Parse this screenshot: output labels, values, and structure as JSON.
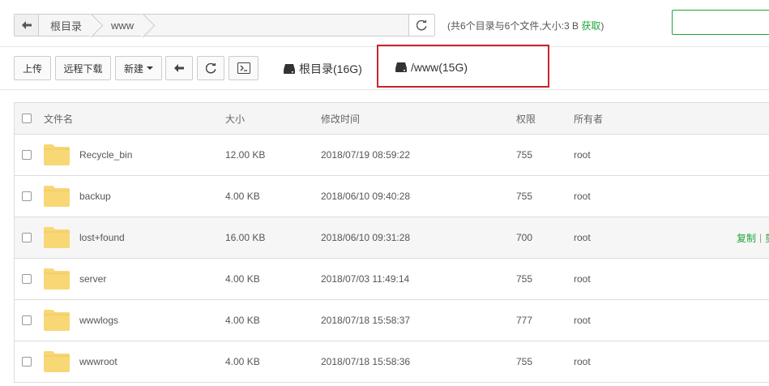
{
  "address": {
    "crumbs": [
      "根目录",
      "www"
    ]
  },
  "summary": {
    "text": "(共6个目录与6个文件,大小:3 B ",
    "link": "获取",
    "tail": ")"
  },
  "toolbar": {
    "upload": "上传",
    "remote_download": "远程下载",
    "new": "新建",
    "disks": [
      {
        "label": "根目录(16G)"
      },
      {
        "label": "/www(15G)"
      }
    ]
  },
  "table": {
    "headers": {
      "name": "文件名",
      "size": "大小",
      "mtime": "修改时间",
      "perm": "权限",
      "owner": "所有者"
    },
    "rows": [
      {
        "name": "Recycle_bin",
        "size": "12.00 KB",
        "mtime": "2018/07/19 08:59:22",
        "perm": "755",
        "owner": "root"
      },
      {
        "name": "backup",
        "size": "4.00 KB",
        "mtime": "2018/06/10 09:40:28",
        "perm": "755",
        "owner": "root"
      },
      {
        "name": "lost+found",
        "size": "16.00 KB",
        "mtime": "2018/06/10 09:31:28",
        "perm": "700",
        "owner": "root",
        "actions": [
          "复制",
          "剪"
        ]
      },
      {
        "name": "server",
        "size": "4.00 KB",
        "mtime": "2018/07/03 11:49:14",
        "perm": "755",
        "owner": "root"
      },
      {
        "name": "wwwlogs",
        "size": "4.00 KB",
        "mtime": "2018/07/18 15:58:37",
        "perm": "777",
        "owner": "root"
      },
      {
        "name": "wwwroot",
        "size": "4.00 KB",
        "mtime": "2018/07/18 15:58:36",
        "perm": "755",
        "owner": "root"
      }
    ]
  },
  "colors": {
    "accent": "#20a53a",
    "highlight": "#c9252c",
    "folder": "#f8d775"
  }
}
